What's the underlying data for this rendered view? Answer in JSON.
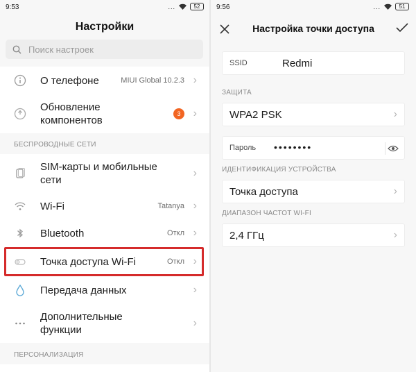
{
  "left": {
    "status": {
      "time": "9:53",
      "signal": "...",
      "battery": "52"
    },
    "title": "Настройки",
    "search": {
      "placeholder": "Поиск настроек"
    },
    "items": [
      {
        "label": "О телефоне",
        "value": "MIUI Global 10.2.3",
        "icon": "info-icon"
      },
      {
        "label": "Обновление компонентов",
        "badge": "3",
        "icon": "update-icon"
      }
    ],
    "sections": [
      "БЕСПРОВОДНЫЕ СЕТИ",
      "ПЕРСОНАЛИЗАЦИЯ"
    ],
    "wireless": [
      {
        "label": "SIM-карты и мобильные сети",
        "icon": "sim-icon"
      },
      {
        "label": "Wi-Fi",
        "value": "Tatanya",
        "icon": "wifi-icon"
      },
      {
        "label": "Bluetooth",
        "value": "Откл",
        "icon": "bluetooth-icon"
      },
      {
        "label": "Точка доступа Wi-Fi",
        "value": "Откл",
        "icon": "hotspot-icon"
      },
      {
        "label": "Передача данных",
        "icon": "data-icon"
      },
      {
        "label": "Дополнительные функции",
        "icon": "more-icon"
      }
    ]
  },
  "right": {
    "status": {
      "time": "9:56",
      "signal": "...",
      "battery": "51"
    },
    "title": "Настройка точки доступа",
    "ssid": {
      "label": "SSID",
      "value": "Redmi"
    },
    "security": {
      "section": "ЗАЩИТА",
      "value": "WPA2 PSK"
    },
    "password": {
      "label": "Пароль",
      "value": "••••••••"
    },
    "device_id": {
      "section": "ИДЕНТИФИКАЦИЯ УСТРОЙСТВА",
      "value": "Точка доступа"
    },
    "band": {
      "section": "ДИАПАЗОН ЧАСТОТ WI-FI",
      "value": "2,4 ГГц"
    }
  }
}
